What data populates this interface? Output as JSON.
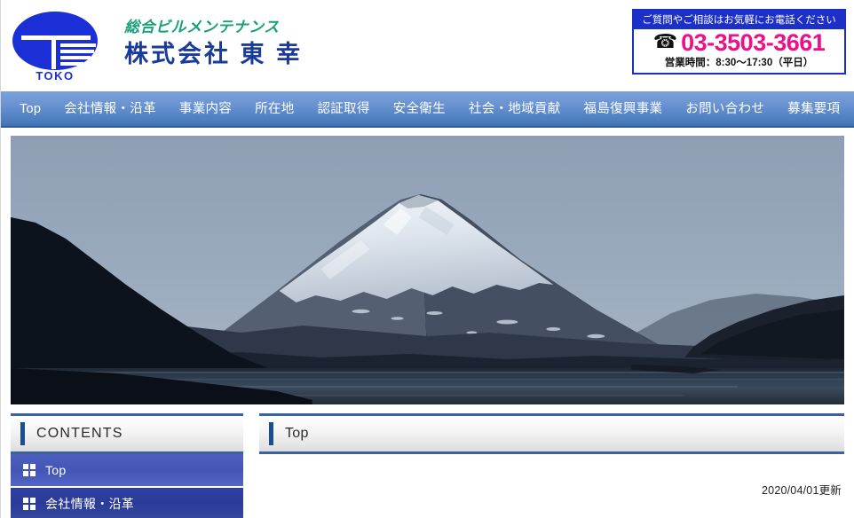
{
  "header": {
    "logo": {
      "mark_text": "TOKO",
      "alt": "toko-logo"
    },
    "tagline": "総合ビルメンテナンス",
    "company_name": "株式会社 東 幸",
    "phone_box": {
      "heading": "ご質問やご相談はお気軽にお電話ください",
      "icon": "telephone-icon",
      "icon_glyph": "☎",
      "number": "03-3503-3661",
      "hours": "営業時間：8:30〜17:30（平日）",
      "border_color": "#1a2fc4",
      "heading_bg": "#1c2fc6",
      "number_color": "#ed0f8c"
    }
  },
  "nav": {
    "items": [
      {
        "label": "Top",
        "name": "nav-item-top"
      },
      {
        "label": "会社情報・沿革",
        "name": "nav-item-company-info"
      },
      {
        "label": "事業内容",
        "name": "nav-item-business"
      },
      {
        "label": "所在地",
        "name": "nav-item-location"
      },
      {
        "label": "認証取得",
        "name": "nav-item-certification"
      },
      {
        "label": "安全衛生",
        "name": "nav-item-safety"
      },
      {
        "label": "社会・地域貢献",
        "name": "nav-item-social-contribution"
      },
      {
        "label": "福島復興事業",
        "name": "nav-item-fukushima"
      },
      {
        "label": "お問い合わせ",
        "name": "nav-item-contact"
      },
      {
        "label": "募集要項",
        "name": "nav-item-recruit"
      }
    ]
  },
  "hero": {
    "name": "hero-image-mount-fuji",
    "description": "富士山と湖の風景写真",
    "sky_color": "#9aa9bc",
    "snow_color": "#e8edf3"
  },
  "sidebar": {
    "title": "CONTENTS",
    "items": [
      {
        "label": "Top",
        "name": "sidebar-item-top",
        "state": "active"
      },
      {
        "label": "会社情報・沿革",
        "name": "sidebar-item-company-info",
        "state": "normal"
      }
    ]
  },
  "main": {
    "title": "Top",
    "updated": "2020/04/01更新"
  },
  "colors": {
    "nav_top": "#7ba1da",
    "nav_bottom": "#3f6fae",
    "panel_border": "#39639a",
    "accent_bar": "#1b4e8e",
    "brand_blue": "#1a3a9c",
    "tagline_green": "#18a07a"
  }
}
